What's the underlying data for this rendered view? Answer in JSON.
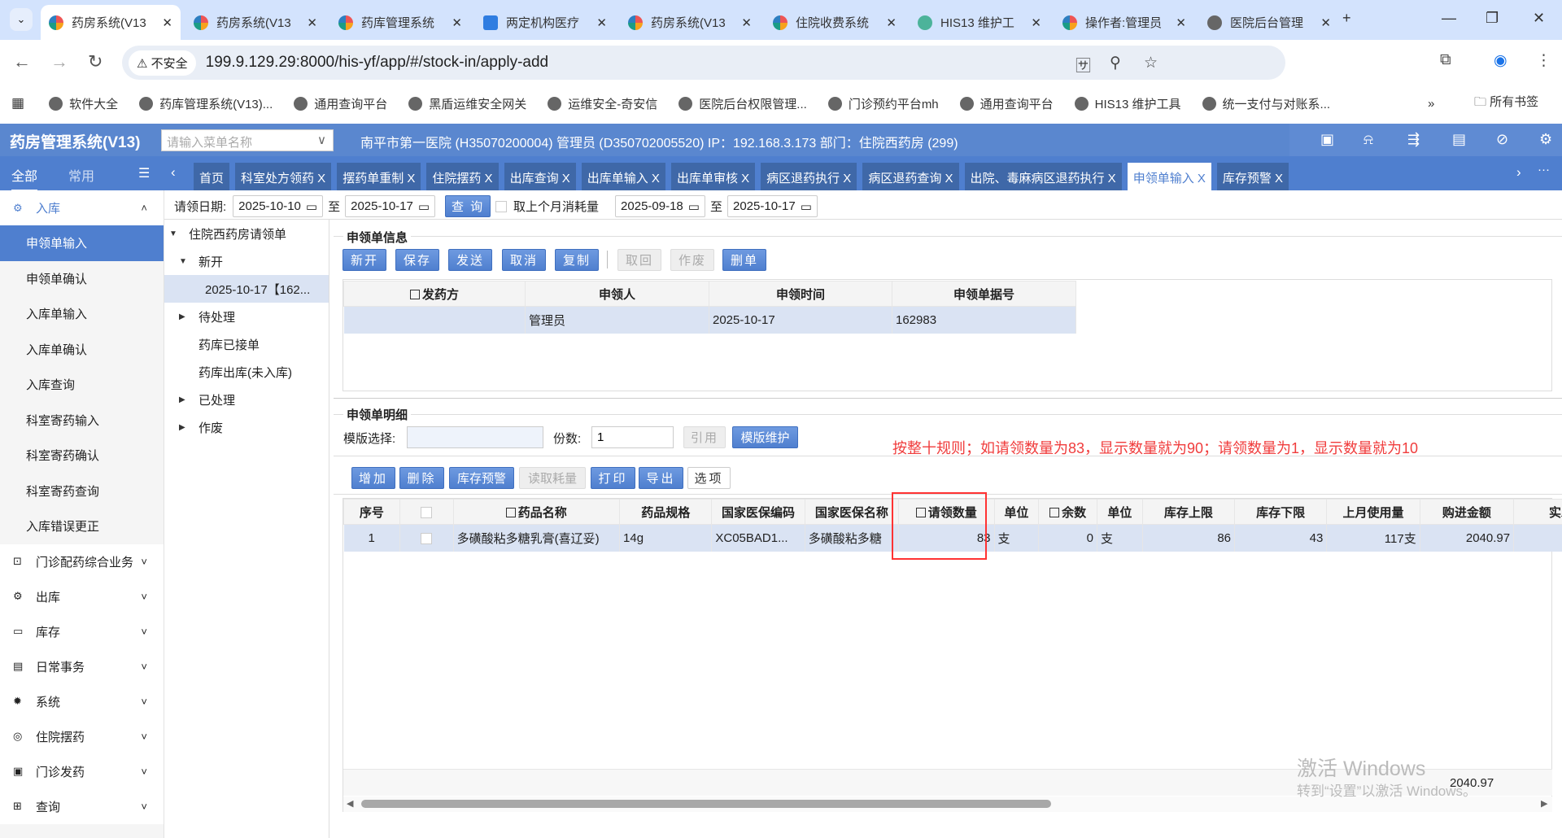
{
  "browser": {
    "tabs": [
      {
        "title": "药房系统(V13",
        "icon": "app-logo"
      },
      {
        "title": "药房系统(V13",
        "icon": "app-logo"
      },
      {
        "title": "药库管理系统",
        "icon": "app-logo"
      },
      {
        "title": "两定机构医疗",
        "icon": "chs-logo"
      },
      {
        "title": "药房系统(V13",
        "icon": "app-logo"
      },
      {
        "title": "住院收费系统",
        "icon": "app-logo"
      },
      {
        "title": "HIS13 维护工",
        "icon": "his-logo"
      },
      {
        "title": "操作者:管理员",
        "icon": "app-logo"
      },
      {
        "title": "医院后台管理",
        "icon": "globe"
      }
    ],
    "security": "不安全",
    "url": "199.9.129.29:8000/his-yf/app/#/stock-in/apply-add",
    "bookmarks": [
      "软件大全",
      "药库管理系统(V13)...",
      "通用查询平台",
      "黑盾运维安全网关",
      "运维安全-奇安信",
      "医院后台权限管理...",
      "门诊预约平台mh",
      "通用查询平台",
      "HIS13 维护工具",
      "统一支付与对账系..."
    ],
    "more": "»",
    "all_bookmarks": "所有书签"
  },
  "app": {
    "name": "药房管理系统(V13)",
    "menu_search_placeholder": "请输入菜单名称",
    "user_info": "南平市第一医院 (H35070200004) 管理员 (D350702005520) IP：192.168.3.173 部门：住院西药房 (299)",
    "modes": [
      "全部",
      "常用"
    ],
    "page_tabs": [
      {
        "label": "首页",
        "closable": false
      },
      {
        "label": "科室处方领药 X"
      },
      {
        "label": "摆药单重制 X"
      },
      {
        "label": "住院摆药 X"
      },
      {
        "label": "出库查询 X"
      },
      {
        "label": "出库单输入 X"
      },
      {
        "label": "出库单审核 X"
      },
      {
        "label": "病区退药执行 X"
      },
      {
        "label": "病区退药查询 X"
      },
      {
        "label": "出院、毒麻病区退药执行 X"
      },
      {
        "label": "申领单输入 X",
        "active": true
      },
      {
        "label": "库存预警 X"
      }
    ],
    "accent": "#4f7fcf"
  },
  "sidebar": {
    "open_group": "入库",
    "items": [
      "申领单输入",
      "申领单确认",
      "入库单输入",
      "入库单确认",
      "入库查询",
      "科室寄药输入",
      "科室寄药确认",
      "科室寄药查询",
      "入库错误更正"
    ],
    "groups": [
      "门诊配药综合业务",
      "出库",
      "库存",
      "日常事务",
      "系统",
      "住院摆药",
      "门诊发药",
      "查询"
    ]
  },
  "filter": {
    "label": "请领日期:",
    "from": "2025-10-10",
    "to_label": "至",
    "to": "2025-10-17",
    "query": "查 询",
    "last_month": "取上个月消耗量",
    "from2": "2025-09-18",
    "to2": "2025-10-17"
  },
  "tree": {
    "root": "住院西药房请领单",
    "new": "新开",
    "selected": "2025-10-17【162...",
    "pending": "待处理",
    "accepted": "药库已接单",
    "shipped": "药库出库(未入库)",
    "done": "已处理",
    "void": "作废"
  },
  "info": {
    "title": "申领单信息",
    "buttons": [
      "新开",
      "保存",
      "发送",
      "取消",
      "复制",
      "取回",
      "作废",
      "删单"
    ],
    "columns": [
      "发药方",
      "申领人",
      "申领时间",
      "申领单据号"
    ],
    "row": [
      "",
      "管理员",
      "2025-10-17",
      "162983"
    ]
  },
  "detail": {
    "title": "申领单明细",
    "template_label": "模版选择:",
    "template_value": "",
    "copies_label": "份数:",
    "copies_value": "1",
    "cite": "引用",
    "template_maint": "模版维护",
    "note": "按整十规则；如请领数量为83，显示数量就为90；请领数量为1，显示数量就为10",
    "buttons": [
      "增加",
      "删除",
      "库存预警",
      "读取耗量",
      "打印",
      "导出",
      "选项"
    ],
    "columns": [
      "序号",
      "",
      "药品名称",
      "药品规格",
      "国家医保编码",
      "国家医保名称",
      "请领数量",
      "单位",
      "余数",
      "单位",
      "库存上限",
      "库存下限",
      "上月使用量",
      "购进金额",
      "实发数量"
    ],
    "rows": [
      [
        "1",
        "",
        "多磺酸粘多糖乳膏(喜辽妥)",
        "14g",
        "XC05BAD1...",
        "多磺酸粘多糖",
        "83",
        "支",
        "0",
        "支",
        "86",
        "43",
        "117支",
        "2040.97",
        ""
      ]
    ],
    "footer_total": "2040.97"
  },
  "watermark": {
    "line1": "激活 Windows",
    "line2": "转到“设置”以激活 Windows。"
  }
}
